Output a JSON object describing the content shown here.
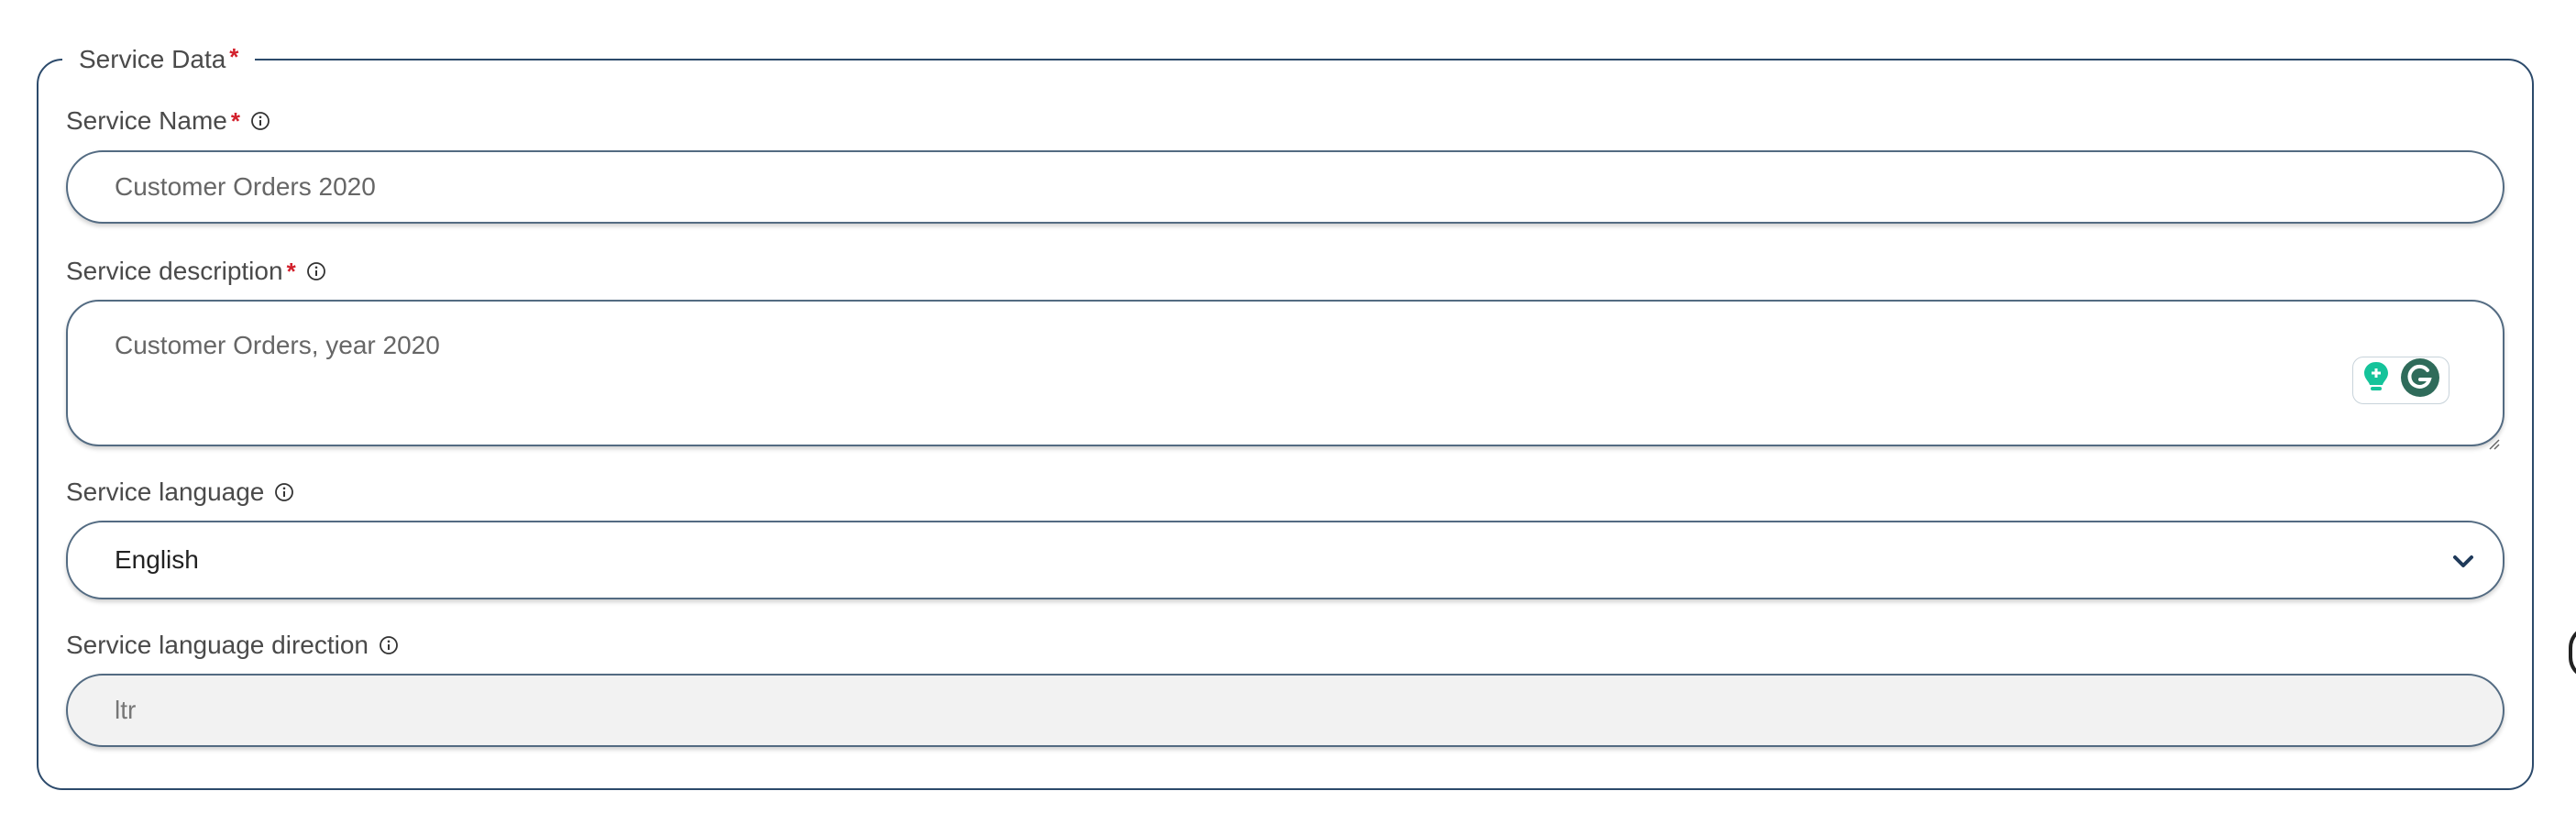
{
  "section": {
    "legend": "Service Data",
    "required_mark": "*"
  },
  "fields": {
    "service_name": {
      "label": "Service Name",
      "required_mark": "*",
      "value": "Customer Orders 2020"
    },
    "service_description": {
      "label": "Service description",
      "required_mark": "*",
      "value": "Customer Orders, year 2020"
    },
    "service_language": {
      "label": "Service language",
      "value": "English"
    },
    "service_language_direction": {
      "label": "Service language direction",
      "value": "ltr"
    }
  },
  "icons": {
    "info": "info-circle-icon",
    "dropdown": "chevron-down-icon",
    "grammarly_suggest": "lightbulb-icon",
    "grammarly_logo": "grammarly-g-icon"
  },
  "colors": {
    "border": "#2c4a6b",
    "input_border": "#536b82",
    "required": "#d21f2b",
    "grammarly_green": "#15c39a",
    "grammarly_dark": "#2f6b5a"
  }
}
